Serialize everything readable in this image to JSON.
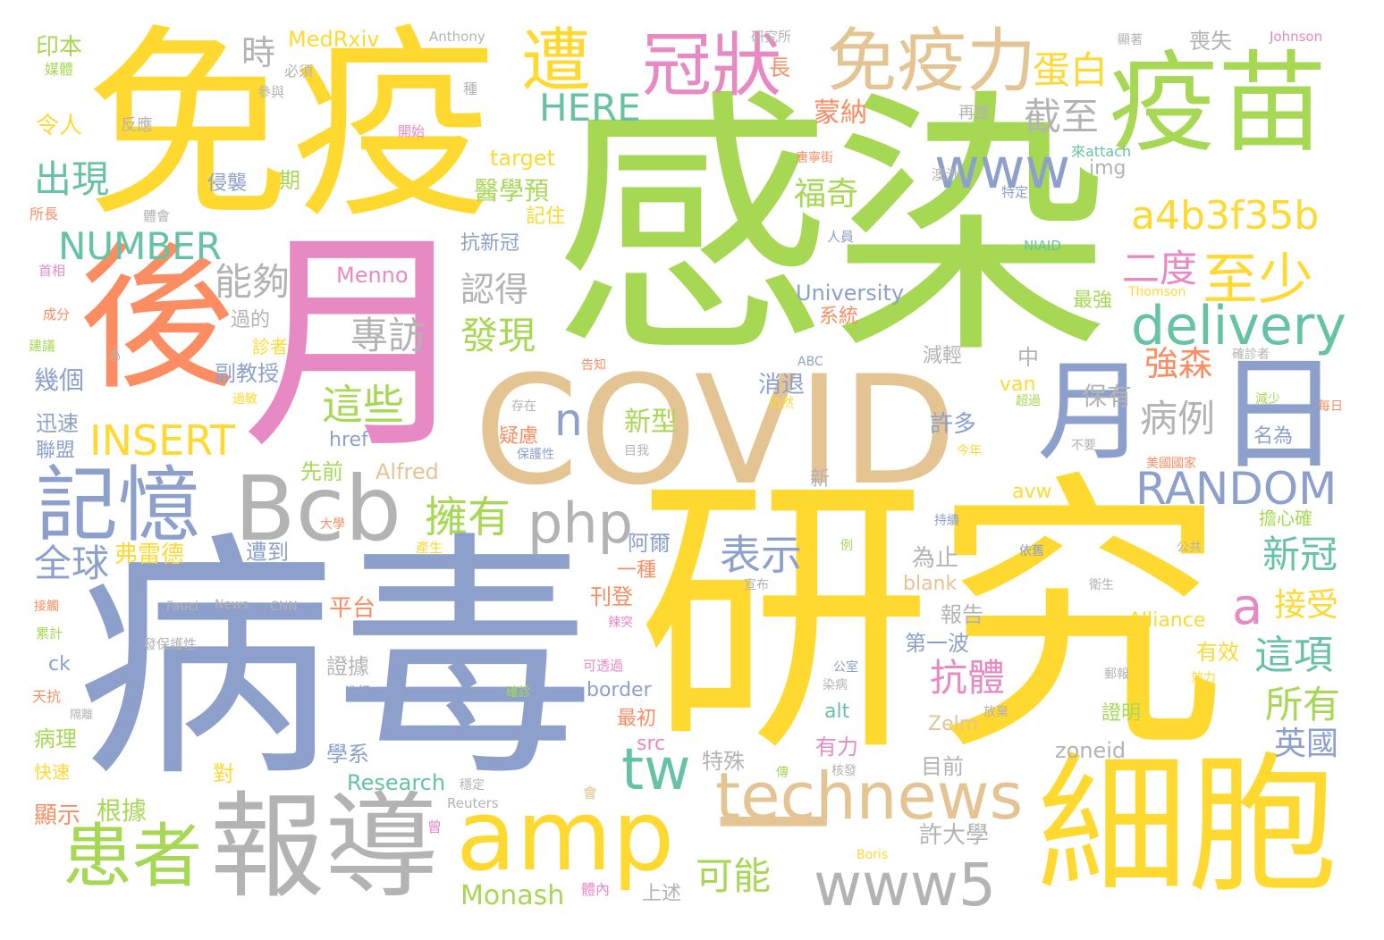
{
  "palette": {
    "yellow": "#FFD92F",
    "green": "#A6D854",
    "blue": "#8DA0CB",
    "orange": "#FC8D62",
    "pink": "#E78AC3",
    "tan": "#E5C494",
    "gray": "#B3B3B3",
    "teal": "#66C2A5"
  },
  "words": [
    {
      "text": "感染",
      "color": "#A6D854"
    },
    {
      "text": "研究",
      "color": "#FFD92F"
    },
    {
      "text": "病毒",
      "color": "#8DA0CB"
    },
    {
      "text": "免疫",
      "color": "#FFD92F"
    },
    {
      "text": "月",
      "color": "#E78AC3"
    },
    {
      "text": "後",
      "color": "#FC8D62"
    },
    {
      "text": "COVID",
      "color": "#E5C494"
    },
    {
      "text": "疫苗",
      "color": "#A6D854"
    },
    {
      "text": "細胞",
      "color": "#FFD92F"
    },
    {
      "text": "報導",
      "color": "#B3B3B3"
    },
    {
      "text": "一",
      "color": "#E5C494"
    },
    {
      "text": "日",
      "color": "#8DA0CB"
    },
    {
      "text": "月",
      "color": "#8DA0CB"
    },
    {
      "text": "Bcb",
      "color": "#B3B3B3"
    },
    {
      "text": "amp",
      "color": "#FFD92F"
    },
    {
      "text": "記憶",
      "color": "#8DA0CB"
    },
    {
      "text": "免疫力",
      "color": "#E5C494"
    },
    {
      "text": "冠狀",
      "color": "#E78AC3"
    },
    {
      "text": "遭",
      "color": "#FFD92F"
    },
    {
      "text": "患者",
      "color": "#A6D854"
    },
    {
      "text": "technews",
      "color": "#E5C494"
    },
    {
      "text": "www5",
      "color": "#B3B3B3"
    },
    {
      "text": "www",
      "color": "#8DA0CB"
    },
    {
      "text": "delivery",
      "color": "#66C2A5"
    },
    {
      "text": "php",
      "color": "#B3B3B3"
    },
    {
      "text": "至少",
      "color": "#FFD92F"
    },
    {
      "text": "tw",
      "color": "#66C2A5"
    },
    {
      "text": "RANDOM",
      "color": "#8DA0CB"
    },
    {
      "text": "a4b3f35b",
      "color": "#FFD92F"
    },
    {
      "text": "INSERT",
      "color": "#FFD92F"
    },
    {
      "text": "NUMBER",
      "color": "#66C2A5"
    },
    {
      "text": "HERE",
      "color": "#66C2A5"
    },
    {
      "text": "擁有",
      "color": "#A6D854"
    },
    {
      "text": "蛋白",
      "color": "#FFD92F"
    },
    {
      "text": "截至",
      "color": "#B3B3B3"
    },
    {
      "text": "n",
      "color": "#8DA0CB"
    },
    {
      "text": "a",
      "color": "#E78AC3"
    },
    {
      "text": "二度",
      "color": "#E78AC3"
    },
    {
      "text": "這些",
      "color": "#A6D854"
    },
    {
      "text": "專訪",
      "color": "#B3B3B3"
    },
    {
      "text": "發現",
      "color": "#A6D854"
    },
    {
      "text": "認得",
      "color": "#B3B3B3"
    },
    {
      "text": "能夠",
      "color": "#B3B3B3"
    },
    {
      "text": "出現",
      "color": "#66C2A5"
    },
    {
      "text": "時",
      "color": "#B3B3B3"
    },
    {
      "text": "全球",
      "color": "#8DA0CB"
    },
    {
      "text": "表示",
      "color": "#8DA0CB"
    },
    {
      "text": "抗體",
      "color": "#E78AC3"
    },
    {
      "text": "強森",
      "color": "#FC8D62"
    },
    {
      "text": "病例",
      "color": "#B3B3B3"
    },
    {
      "text": "新冠",
      "color": "#66C2A5"
    },
    {
      "text": "接受",
      "color": "#FFD92F"
    },
    {
      "text": "這項",
      "color": "#66C2A5"
    },
    {
      "text": "所有",
      "color": "#A6D854"
    },
    {
      "text": "英國",
      "color": "#8DA0CB"
    },
    {
      "text": "可能",
      "color": "#A6D854"
    },
    {
      "text": "福奇",
      "color": "#A6D854"
    },
    {
      "text": "蒙納",
      "color": "#FC8D62"
    },
    {
      "text": "醫學預",
      "color": "#A6D854"
    },
    {
      "text": "新型",
      "color": "#A6D854"
    },
    {
      "text": "喪失",
      "color": "#B3B3B3"
    },
    {
      "text": "長",
      "color": "#FC8D62"
    },
    {
      "text": "印本",
      "color": "#A6D854"
    },
    {
      "text": "MedRxiv",
      "color": "#FFD92F"
    },
    {
      "text": "Anthony",
      "color": "#B3B3B3"
    },
    {
      "text": "研究所",
      "color": "#B3B3B3"
    },
    {
      "text": "顯著",
      "color": "#B3B3B3"
    },
    {
      "text": "Johnson",
      "color": "#E78AC3"
    },
    {
      "text": "媒體",
      "color": "#A6D854"
    },
    {
      "text": "必須",
      "color": "#B3B3B3"
    },
    {
      "text": "參與",
      "color": "#B3B3B3"
    },
    {
      "text": "種",
      "color": "#B3B3B3"
    },
    {
      "text": "令人",
      "color": "#FFD92F"
    },
    {
      "text": "反應",
      "color": "#B3B3B3"
    },
    {
      "text": "開始",
      "color": "#E78AC3"
    },
    {
      "text": "再度",
      "color": "#B3B3B3"
    },
    {
      "text": "target",
      "color": "#FFD92F"
    },
    {
      "text": "img",
      "color": "#B3B3B3"
    },
    {
      "text": "唐寧街",
      "color": "#FC8D62"
    },
    {
      "text": "來attach",
      "color": "#66C2A5"
    },
    {
      "text": "侵襲",
      "color": "#8DA0CB"
    },
    {
      "text": "期",
      "color": "#A6D854"
    },
    {
      "text": "澳洲",
      "color": "#B3B3B3"
    },
    {
      "text": "特定",
      "color": "#8DA0CB"
    },
    {
      "text": "記住",
      "color": "#FFD92F"
    },
    {
      "text": "所長",
      "color": "#FC8D62"
    },
    {
      "text": "體會",
      "color": "#B3B3B3"
    },
    {
      "text": "人員",
      "color": "#8DA0CB"
    },
    {
      "text": "NIAID",
      "color": "#66C2A5"
    },
    {
      "text": "首相",
      "color": "#E78AC3"
    },
    {
      "text": "Menno",
      "color": "#E78AC3"
    },
    {
      "text": "University",
      "color": "#8DA0CB"
    },
    {
      "text": "Thomson",
      "color": "#FFD92F"
    },
    {
      "text": "抗新冠",
      "color": "#8DA0CB"
    },
    {
      "text": "最強",
      "color": "#A6D854"
    },
    {
      "text": "成分",
      "color": "#FC8D62"
    },
    {
      "text": "過的",
      "color": "#B3B3B3"
    },
    {
      "text": "系統",
      "color": "#FC8D62"
    },
    {
      "text": "建議",
      "color": "#A6D854"
    },
    {
      "text": "診者",
      "color": "#FFD92F"
    },
    {
      "text": "為",
      "color": "#B3B3B3"
    },
    {
      "text": "ABC",
      "color": "#8DA0CB"
    },
    {
      "text": "減輕",
      "color": "#B3B3B3"
    },
    {
      "text": "中",
      "color": "#B3B3B3"
    },
    {
      "text": "確診者",
      "color": "#B3B3B3"
    },
    {
      "text": "幾個",
      "color": "#8DA0CB"
    },
    {
      "text": "副教授",
      "color": "#8DA0CB"
    },
    {
      "text": "告知",
      "color": "#FC8D62"
    },
    {
      "text": "消退",
      "color": "#8DA0CB"
    },
    {
      "text": "van",
      "color": "#FFD92F"
    },
    {
      "text": "保有",
      "color": "#B3B3B3"
    },
    {
      "text": "過敏",
      "color": "#FFD92F"
    },
    {
      "text": "存在",
      "color": "#B3B3B3"
    },
    {
      "text": "仍然",
      "color": "#FFD92F"
    },
    {
      "text": "許多",
      "color": "#8DA0CB"
    },
    {
      "text": "超過",
      "color": "#A6D854"
    },
    {
      "text": "減少",
      "color": "#A6D854"
    },
    {
      "text": "每日",
      "color": "#FC8D62"
    },
    {
      "text": "迅速",
      "color": "#8DA0CB"
    },
    {
      "text": "聯盟",
      "color": "#8DA0CB"
    },
    {
      "text": "href",
      "color": "#8DA0CB"
    },
    {
      "text": "疑慮",
      "color": "#FC8D62"
    },
    {
      "text": "今年",
      "color": "#FFD92F"
    },
    {
      "text": "名為",
      "color": "#8DA0CB"
    },
    {
      "text": "目我",
      "color": "#B3B3B3"
    },
    {
      "text": "保護性",
      "color": "#8DA0CB"
    },
    {
      "text": "不要",
      "color": "#B3B3B3"
    },
    {
      "text": "美國國家",
      "color": "#FC8D62"
    },
    {
      "text": "先前",
      "color": "#A6D854"
    },
    {
      "text": "Alfred",
      "color": "#E5C494"
    },
    {
      "text": "新",
      "color": "#B3B3B3"
    },
    {
      "text": "avw",
      "color": "#FFD92F"
    },
    {
      "text": "大學",
      "color": "#FC8D62"
    },
    {
      "text": "持續",
      "color": "#8DA0CB"
    },
    {
      "text": "擔心確",
      "color": "#A6D854"
    },
    {
      "text": "弗雷德",
      "color": "#FFD92F"
    },
    {
      "text": "遭到",
      "color": "#8DA0CB"
    },
    {
      "text": "產生",
      "color": "#FFD92F"
    },
    {
      "text": "阿爾",
      "color": "#8DA0CB"
    },
    {
      "text": "為止",
      "color": "#B3B3B3"
    },
    {
      "text": "例",
      "color": "#A6D854"
    },
    {
      "text": "依舊",
      "color": "#8DA0CB"
    },
    {
      "text": "公共",
      "color": "#B3B3B3"
    },
    {
      "text": "一種",
      "color": "#FC8D62"
    },
    {
      "text": "宣布",
      "color": "#B3B3B3"
    },
    {
      "text": "blank",
      "color": "#E5C494"
    },
    {
      "text": "衛生",
      "color": "#B3B3B3"
    },
    {
      "text": "接觸",
      "color": "#FC8D62"
    },
    {
      "text": "Fauci",
      "color": "#B3B3B3"
    },
    {
      "text": "News",
      "color": "#B3B3B3"
    },
    {
      "text": "CNN",
      "color": "#B3B3B3"
    },
    {
      "text": "平台",
      "color": "#FC8D62"
    },
    {
      "text": "刊登",
      "color": "#FC8D62"
    },
    {
      "text": "報告",
      "color": "#B3B3B3"
    },
    {
      "text": "Alliance",
      "color": "#FFD92F"
    },
    {
      "text": "累計",
      "color": "#A6D854"
    },
    {
      "text": "發保護性",
      "color": "#B3B3B3"
    },
    {
      "text": "辣突",
      "color": "#E78AC3"
    },
    {
      "text": "第一波",
      "color": "#8DA0CB"
    },
    {
      "text": "有效",
      "color": "#FFD92F"
    },
    {
      "text": "ck",
      "color": "#8DA0CB"
    },
    {
      "text": "證據",
      "color": "#B3B3B3"
    },
    {
      "text": "可透過",
      "color": "#E78AC3"
    },
    {
      "text": "公室",
      "color": "#8DA0CB"
    },
    {
      "text": "郵報",
      "color": "#B3B3B3"
    },
    {
      "text": "天抗",
      "color": "#FC8D62"
    },
    {
      "text": "進行",
      "color": "#8DA0CB"
    },
    {
      "text": "確診",
      "color": "#A6D854"
    },
    {
      "text": "border",
      "color": "#8DA0CB"
    },
    {
      "text": "染病",
      "color": "#B3B3B3"
    },
    {
      "text": "效力",
      "color": "#FFD92F"
    },
    {
      "text": "隔離",
      "color": "#B3B3B3"
    },
    {
      "text": "最初",
      "color": "#FC8D62"
    },
    {
      "text": "alt",
      "color": "#66C2A5"
    },
    {
      "text": "Zelm",
      "color": "#E5C494"
    },
    {
      "text": "放棄",
      "color": "#B3B3B3"
    },
    {
      "text": "證明",
      "color": "#A6D854"
    },
    {
      "text": "病理",
      "color": "#A6D854"
    },
    {
      "text": "src",
      "color": "#E78AC3"
    },
    {
      "text": "有力",
      "color": "#E78AC3"
    },
    {
      "text": "zoneid",
      "color": "#B3B3B3"
    },
    {
      "text": "學系",
      "color": "#8DA0CB"
    },
    {
      "text": "特殊",
      "color": "#B3B3B3"
    },
    {
      "text": "快速",
      "color": "#FFD92F"
    },
    {
      "text": "對",
      "color": "#FFD92F"
    },
    {
      "text": "Research",
      "color": "#66C2A5"
    },
    {
      "text": "穩定",
      "color": "#B3B3B3"
    },
    {
      "text": "傳",
      "color": "#A6D854"
    },
    {
      "text": "核發",
      "color": "#B3B3B3"
    },
    {
      "text": "目前",
      "color": "#B3B3B3"
    },
    {
      "text": "根據",
      "color": "#A6D854"
    },
    {
      "text": "顯示",
      "color": "#FC8D62"
    },
    {
      "text": "會",
      "color": "#E5C494"
    },
    {
      "text": "Reuters",
      "color": "#B3B3B3"
    },
    {
      "text": "曾",
      "color": "#E78AC3"
    },
    {
      "text": "許大學",
      "color": "#B3B3B3"
    },
    {
      "text": "Boris",
      "color": "#FFD92F"
    },
    {
      "text": "Monash",
      "color": "#A6D854"
    },
    {
      "text": "體內",
      "color": "#E78AC3"
    },
    {
      "text": "上述",
      "color": "#B3B3B3"
    }
  ]
}
